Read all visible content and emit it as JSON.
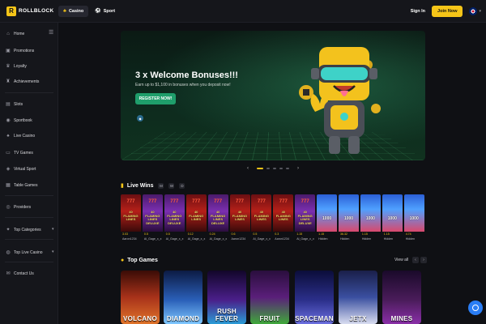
{
  "brand": {
    "name": "ROLLBLOCK"
  },
  "topbar": {
    "tabs": [
      {
        "label": "Casino",
        "active": true
      },
      {
        "label": "Sport",
        "active": false
      }
    ],
    "signin_label": "Sign In",
    "join_label": "Join Now"
  },
  "sidebar": {
    "items": [
      {
        "label": "Home",
        "icon": "home-icon"
      },
      {
        "label": "Promotions",
        "icon": "gift-icon"
      },
      {
        "label": "Loyalty",
        "icon": "crown-icon"
      },
      {
        "label": "Achievements",
        "icon": "trophy-icon"
      },
      {
        "label": "Slots",
        "icon": "slots-icon"
      },
      {
        "label": "Sportbook",
        "icon": "ball-icon"
      },
      {
        "label": "Live Casino",
        "icon": "cards-icon"
      },
      {
        "label": "TV Games",
        "icon": "tv-icon"
      },
      {
        "label": "Virtual Sport",
        "icon": "gamepad-icon"
      },
      {
        "label": "Table Games",
        "icon": "table-icon"
      },
      {
        "label": "Providers",
        "icon": "providers-icon"
      },
      {
        "label": "Top Categories",
        "icon": "star-icon"
      },
      {
        "label": "Top Live Casino",
        "icon": "live-icon"
      },
      {
        "label": "Contact Us",
        "icon": "chat-icon"
      }
    ]
  },
  "banner": {
    "title": "3 x Welcome Bonuses!!!",
    "subtitle": "Earn up to $1,100 in bonuses when you deposit now!",
    "cta_label": "REGISTER NOW!",
    "slides": 5,
    "active_slide": 1
  },
  "live_wins": {
    "title": "Live Wins",
    "periods": [
      "M",
      "W",
      "D"
    ],
    "items": [
      {
        "game": "40 FLAMING LINES",
        "amount": "3.03",
        "user": "Aaron1234"
      },
      {
        "game": "40 FLAMING LINES DELUXE",
        "amount": "0.5",
        "user": "Al_Gage_x_x"
      },
      {
        "game": "40 FLAMING LINES DELUXE",
        "amount": "0.5",
        "user": "Al_Gage_x_x"
      },
      {
        "game": "40 FLAMING LINES",
        "amount": "0.12",
        "user": "Al_Gage_x_x"
      },
      {
        "game": "40 FLAMING LINES DELUXE",
        "amount": "0.24",
        "user": "Al_Gage_x_x"
      },
      {
        "game": "40 FLAMING LINES",
        "amount": "0.6",
        "user": "Aaron1234"
      },
      {
        "game": "40 FLAMING LINES",
        "amount": "0.5",
        "user": "Al_Gage_x_x"
      },
      {
        "game": "40 FLAMING LINES",
        "amount": "0.3",
        "user": "Aaron1234"
      },
      {
        "game": "40 FLAMING LINES DELUXE",
        "amount": "1.15",
        "user": "Al_Gage_x_x"
      },
      {
        "game": "1000",
        "amount": "1.15",
        "user": "Hidden"
      },
      {
        "game": "1000",
        "amount": "36.32",
        "user": "Hidden"
      },
      {
        "game": "1000",
        "amount": "1.15",
        "user": "Hidden"
      },
      {
        "game": "1000",
        "amount": "1.15",
        "user": "Hidden"
      },
      {
        "game": "1000",
        "amount": "4.74",
        "user": "Hidden"
      }
    ]
  },
  "top_games": {
    "title": "Top Games",
    "view_all_label": "View all",
    "items": [
      {
        "name": "VOLCANO"
      },
      {
        "name": "DIAMOND"
      },
      {
        "name": "RUSH FEVER"
      },
      {
        "name": "FRUIT"
      },
      {
        "name": "SPACEMAN"
      },
      {
        "name": "JETX"
      },
      {
        "name": "MINES"
      }
    ]
  },
  "colors": {
    "accent": "#f5c518",
    "cta": "#1f9e6b",
    "chat": "#2a7df4"
  }
}
